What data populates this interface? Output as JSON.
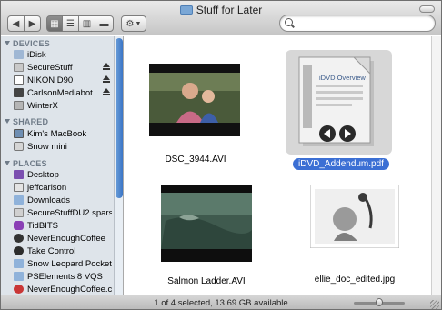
{
  "window": {
    "title": "Stuff for Later"
  },
  "toolbar": {
    "back_icon": "back-arrow-icon",
    "forward_icon": "forward-arrow-icon",
    "view_buttons": [
      "icon-view",
      "list-view",
      "column-view",
      "coverflow-view"
    ],
    "action_icon": "gear-icon",
    "search": {
      "value": "",
      "placeholder": ""
    }
  },
  "sidebar": {
    "sections": [
      {
        "heading": "DEVICES",
        "items": [
          {
            "label": "iDisk",
            "icon": "idisk-icon",
            "eject": false
          },
          {
            "label": "SecureStuff",
            "icon": "disk-image-icon",
            "eject": true
          },
          {
            "label": "NIKON D90",
            "icon": "camera-drive-icon",
            "eject": true
          },
          {
            "label": "CarlsonMediabot",
            "icon": "external-drive-icon",
            "eject": true
          },
          {
            "label": "WinterX",
            "icon": "hard-drive-icon",
            "eject": false
          }
        ]
      },
      {
        "heading": "SHARED",
        "items": [
          {
            "label": "Kim's MacBook",
            "icon": "laptop-icon",
            "eject": false
          },
          {
            "label": "Snow mini",
            "icon": "mac-mini-icon",
            "eject": false
          }
        ]
      },
      {
        "heading": "PLACES",
        "items": [
          {
            "label": "Desktop",
            "icon": "desktop-icon",
            "eject": false
          },
          {
            "label": "jeffcarlson",
            "icon": "home-icon",
            "eject": false
          },
          {
            "label": "Downloads",
            "icon": "downloads-folder-icon",
            "eject": false
          },
          {
            "label": "SecureStuffDU2.spars…",
            "icon": "sparse-bundle-icon",
            "eject": false
          },
          {
            "label": "TidBITS",
            "icon": "tidbits-icon",
            "eject": false
          },
          {
            "label": "NeverEnoughCoffee",
            "icon": "coffee-icon",
            "eject": false
          },
          {
            "label": "Take Control",
            "icon": "take-control-icon",
            "eject": false
          },
          {
            "label": "Snow Leopard Pocket …",
            "icon": "folder-icon",
            "eject": false
          },
          {
            "label": "PSElements 8 VQS",
            "icon": "folder-icon",
            "eject": false
          },
          {
            "label": "NeverEnoughCoffee.com",
            "icon": "coffee-cup-icon",
            "eject": false
          }
        ]
      }
    ]
  },
  "files": [
    {
      "name": "DSC_3944.AVI",
      "selected": false,
      "kind": "video"
    },
    {
      "name": "iDVD_Addendum.pdf",
      "selected": true,
      "kind": "pdf",
      "preview_title": "iDVD Overview"
    },
    {
      "name": "Salmon Ladder.AVI",
      "selected": false,
      "kind": "video"
    },
    {
      "name": "ellie_doc_edited.jpg",
      "selected": false,
      "kind": "photo"
    }
  ],
  "status": {
    "text": "1 of 4 selected, 13.69 GB available",
    "icon_size_level": 0.5
  },
  "colors": {
    "selection": "#3b6fd4",
    "sidebar_bg": "#dee4ea",
    "section_heading": "#6f7b88"
  }
}
